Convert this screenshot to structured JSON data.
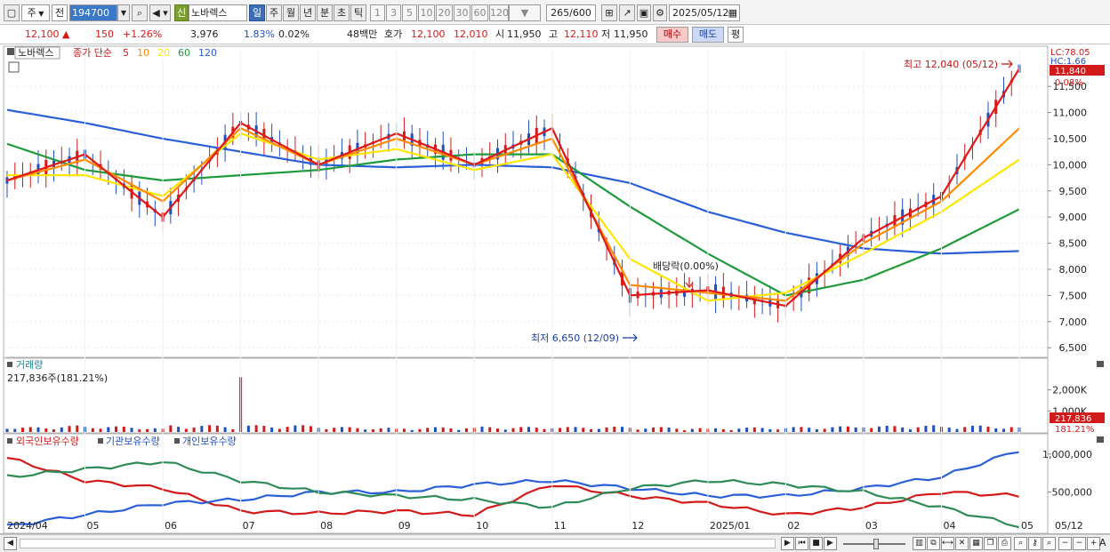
{
  "toolbar": {
    "period_label": "주",
    "prev_label": "전",
    "code_value": "194700",
    "sin_label": "신",
    "stock_name": "노바렉스",
    "period_tabs": [
      "일",
      "주",
      "월",
      "년",
      "분",
      "초",
      "틱"
    ],
    "interval_tabs": [
      "1",
      "3",
      "5",
      "10",
      "20",
      "30",
      "60",
      "120"
    ],
    "count_value": "265",
    "count_max": "/600",
    "date_value": "2025/05/12"
  },
  "infobar": {
    "price": "12,100",
    "change": "150",
    "change_pct": "+1.26%",
    "volume": "3,976",
    "turnover_pct": "1.83%",
    "misc_pct": "0.02%",
    "amount": "48백만",
    "quote_label": "호가",
    "ask": "12,100",
    "bid": "12,010",
    "open_label": "시",
    "open": "11,950",
    "high_label": "고",
    "high": "12,110",
    "low_label": "저",
    "low": "11,950",
    "buy_label": "매수",
    "sell_label": "매도",
    "eval_label": "평"
  },
  "price_panel": {
    "stock_label": "노바렉스",
    "ma_title": "종가 단순",
    "ma_periods": [
      "5",
      "10",
      "20",
      "60",
      "120"
    ],
    "ma_colors": [
      "#e01818",
      "#ff8a00",
      "#ffe600",
      "#1f9a3c",
      "#2a5fd8"
    ],
    "lc_label": "LC:78.05",
    "hc_label": "HC:1.66",
    "current_price_tag": "11,840",
    "current_pct_tag": "0.08%",
    "high_annotation": "최고 12,040 (05/12)",
    "low_annotation": "최저 6,650 (12/09)",
    "dividend_annotation": "배당락(0.00%)",
    "y_ticks": [
      "11,500",
      "11,000",
      "10,500",
      "10,000",
      "9,500",
      "9,000",
      "8,500",
      "8,000",
      "7,500",
      "7,000",
      "6,500"
    ],
    "y_range": [
      6350,
      12200
    ]
  },
  "volume_panel": {
    "title": "거래량",
    "value_label": "217,836주(181.21%)",
    "y_ticks": [
      "2,000K",
      "1,000K"
    ],
    "tag_value": "217,836",
    "tag_pct": "181.21%"
  },
  "holding_panel": {
    "titles": [
      "외국인보유수량",
      "기관보유수량",
      "개인보유수량"
    ],
    "title_colors": [
      "#d21a1a",
      "#1f4fbf",
      "#1f4fbf"
    ],
    "line_colors": [
      "#d21a1a",
      "#2a5fd8",
      "#2e8b57"
    ],
    "y_ticks": [
      "1,000,000",
      "500,000"
    ]
  },
  "x_axis": {
    "labels": [
      "2024/04",
      "05",
      "06",
      "07",
      "08",
      "09",
      "10",
      "11",
      "12",
      "2025/01",
      "02",
      "03",
      "04",
      "05"
    ],
    "right_label": "05/12"
  },
  "chart_data": [
    {
      "type": "line",
      "title": "노바렉스 종가 단순 5 10 20 60 120",
      "x": [
        "2024/04",
        "05",
        "06",
        "07",
        "08",
        "09",
        "10",
        "11",
        "12",
        "2025/01",
        "02",
        "03",
        "04",
        "05"
      ],
      "series": [
        {
          "name": "5",
          "values": [
            9700,
            10200,
            9000,
            10800,
            10000,
            10600,
            10000,
            10700,
            7500,
            7600,
            7300,
            8600,
            9400,
            11840
          ]
        },
        {
          "name": "10",
          "values": [
            9700,
            10100,
            9300,
            10700,
            10000,
            10500,
            10000,
            10500,
            7700,
            7550,
            7400,
            8500,
            9300,
            10700
          ]
        },
        {
          "name": "20",
          "values": [
            9800,
            9800,
            9400,
            10600,
            10100,
            10300,
            9900,
            10200,
            8200,
            7400,
            7550,
            8300,
            9100,
            10100
          ]
        },
        {
          "name": "60",
          "values": [
            10400,
            9900,
            9700,
            9800,
            9900,
            10100,
            10200,
            10200,
            9200,
            8300,
            7500,
            7800,
            8400,
            9150
          ]
        },
        {
          "name": "120",
          "values": [
            11050,
            10800,
            10500,
            10250,
            10000,
            9950,
            10000,
            9950,
            9650,
            9100,
            8700,
            8400,
            8300,
            8350
          ]
        }
      ],
      "ylim": [
        6350,
        12200
      ]
    },
    {
      "type": "bar",
      "title": "거래량",
      "categories": [
        "2024/04",
        "05",
        "06",
        "07",
        "08",
        "09",
        "10",
        "11",
        "12",
        "2025/01",
        "02",
        "03",
        "04",
        "05"
      ],
      "series": [
        {
          "name": "거래량",
          "values": [
            150000,
            250000,
            150000,
            2600000,
            200000,
            150000,
            200000,
            180000,
            200000,
            150000,
            180000,
            220000,
            250000,
            217836
          ]
        }
      ]
    },
    {
      "type": "line",
      "title": "외국인보유수량 기관보유수량 개인보유수량",
      "x": [
        "2024/04",
        "05",
        "06",
        "07",
        "08",
        "09",
        "10",
        "11",
        "12",
        "2025/01",
        "02",
        "03",
        "04",
        "05"
      ],
      "series": [
        {
          "name": "외국인보유수량",
          "values": [
            950000,
            650000,
            550000,
            250000,
            220000,
            250000,
            200000,
            600000,
            450000,
            350000,
            200000,
            300000,
            500000,
            450000
          ]
        },
        {
          "name": "기관보유수량",
          "values": [
            50000,
            200000,
            350000,
            400000,
            500000,
            500000,
            600000,
            650000,
            550000,
            450000,
            450000,
            550000,
            700000,
            1050000
          ]
        },
        {
          "name": "개인보유수량",
          "values": [
            700000,
            800000,
            900000,
            650000,
            500000,
            450000,
            400000,
            300000,
            550000,
            650000,
            600000,
            500000,
            300000,
            50000
          ]
        }
      ]
    }
  ]
}
